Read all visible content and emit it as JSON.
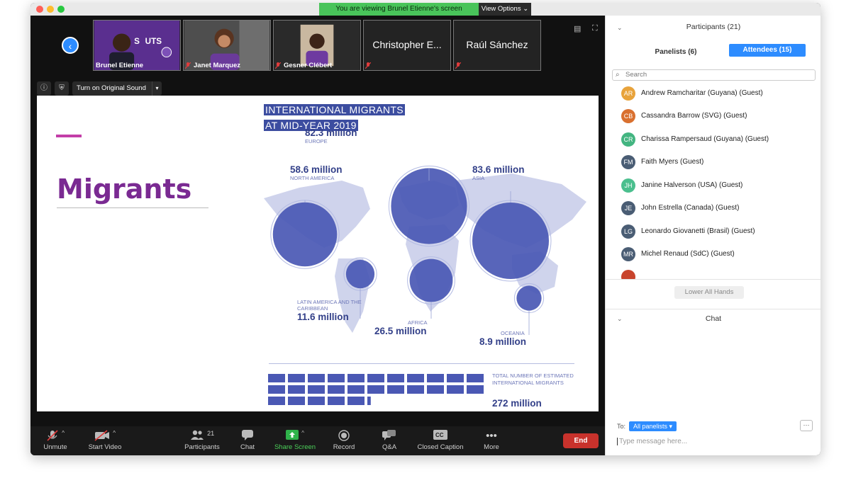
{
  "window": {
    "share_banner": "You are viewing Brunel Etienne's screen",
    "view_options": "View Options ⌄"
  },
  "thumbnails": [
    {
      "name": "Brunel Etienne",
      "type": "video",
      "bg": "#5a2f8f"
    },
    {
      "name": "Janet Marquez",
      "type": "video",
      "bg": "#4b4b4b"
    },
    {
      "name": "Gesner Clébert",
      "type": "video",
      "bg": "#3b3b3b"
    },
    {
      "name": "Christopher E...",
      "type": "name"
    },
    {
      "name": "Raúl Sánchez",
      "type": "name"
    }
  ],
  "slide_controls": {
    "original_sound": "Turn on Original Sound"
  },
  "slide": {
    "title": "Migrants",
    "infographic_title_1": "INTERNATIONAL MIGRANTS",
    "infographic_title_2": "AT MID-YEAR 2019",
    "total_label": "TOTAL NUMBER OF ESTIMATED INTERNATIONAL MIGRANTS",
    "total_value": "272 million",
    "accent_color": "#c33ea8",
    "title_color": "#7a2a92"
  },
  "chart_data": {
    "type": "bubble-map",
    "title": "INTERNATIONAL MIGRANTS AT MID-YEAR 2019",
    "unit": "million",
    "regions": [
      {
        "name": "EUROPE",
        "value": 82.3,
        "label": "82.3 million"
      },
      {
        "name": "ASIA",
        "value": 83.6,
        "label": "83.6 million"
      },
      {
        "name": "NORTH AMERICA",
        "value": 58.6,
        "label": "58.6 million"
      },
      {
        "name": "LATIN AMERICA AND THE CARIBBEAN",
        "value": 11.6,
        "label": "11.6 million"
      },
      {
        "name": "AFRICA",
        "value": 26.5,
        "label": "26.5 million"
      },
      {
        "name": "OCEANIA",
        "value": 8.9,
        "label": "8.9 million"
      }
    ],
    "total": {
      "value": 272,
      "label": "272 million"
    }
  },
  "toolbar": {
    "unmute": "Unmute",
    "start_video": "Start Video",
    "participants": "Participants",
    "participants_count": "21",
    "chat": "Chat",
    "share_screen": "Share Screen",
    "record": "Record",
    "qa": "Q&A",
    "closed_caption": "Closed Caption",
    "more": "More",
    "end": "End"
  },
  "participants_panel": {
    "header": "Participants (21)",
    "tab_panelists": "Panelists (6)",
    "tab_attendees": "Attendees (15)",
    "search_placeholder": "Search",
    "lower_all_hands": "Lower All Hands",
    "list": [
      {
        "initials": "AR",
        "name": "Andrew Ramcharitar (Guyana) (Guest)",
        "color": "#e8a33b"
      },
      {
        "initials": "CB",
        "name": "Cassandra Barrow (SVG) (Guest)",
        "color": "#d9702f"
      },
      {
        "initials": "CR",
        "name": "Charissa Rampersaud (Guyana) (Guest)",
        "color": "#43b581"
      },
      {
        "initials": "FM",
        "name": "Faith Myers (Guest)",
        "color": "#4a5d74"
      },
      {
        "initials": "JH",
        "name": "Janine Halverson (USA) (Guest)",
        "color": "#4bbf8e"
      },
      {
        "initials": "JE",
        "name": "John Estrella (Canada) (Guest)",
        "color": "#4a5d74"
      },
      {
        "initials": "LG",
        "name": "Leonardo Giovanetti (Brasil) (Guest)",
        "color": "#4a5d74"
      },
      {
        "initials": "MR",
        "name": "Michel Renaud (SdC) (Guest)",
        "color": "#4a5d74"
      }
    ]
  },
  "chat_panel": {
    "header": "Chat",
    "to_label": "To:",
    "target": "All panelists ▾",
    "more": "···",
    "input_placeholder": "Type message here..."
  }
}
